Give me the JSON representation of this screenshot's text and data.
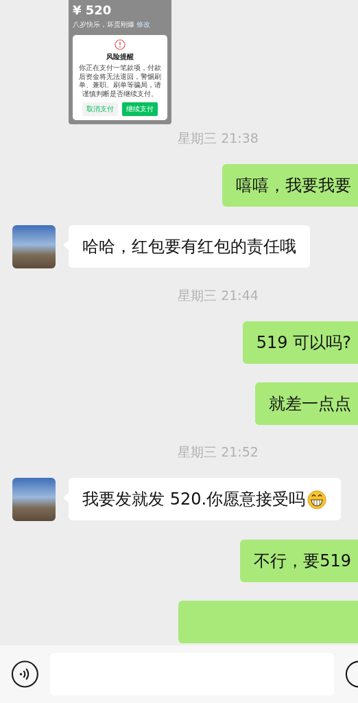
{
  "shared_image": {
    "amount": "¥ 520",
    "note": "八岁快乐，坏蛋刚爆",
    "note_link": "修改",
    "dialog": {
      "title": "风险提醒",
      "message": "你正在支付一笔款项，付款后资金将无法退回，警惕刷单、兼职、刷单等骗局，请谨慎判断是否继续支付。",
      "buttons": [
        {
          "label": "取消支付",
          "kind": "secondary"
        },
        {
          "label": "继续支付",
          "kind": "primary"
        }
      ]
    }
  },
  "messages": [
    {
      "kind": "time",
      "text": "星期三 21:38"
    },
    {
      "kind": "sent",
      "text": "嘻嘻，我要我要"
    },
    {
      "kind": "received",
      "text": "哈哈，红包要有红包的责任哦"
    },
    {
      "kind": "time",
      "text": "星期三 21:44"
    },
    {
      "kind": "sent",
      "text": "519 可以吗?"
    },
    {
      "kind": "sent",
      "text": "就差一点点"
    },
    {
      "kind": "time",
      "text": "星期三 21:52"
    },
    {
      "kind": "received",
      "text": "我要发就发 520.你愿意接受吗",
      "has_emoji": true
    },
    {
      "kind": "sent",
      "text": "不行，要519"
    },
    {
      "kind": "sent_partial"
    }
  ]
}
